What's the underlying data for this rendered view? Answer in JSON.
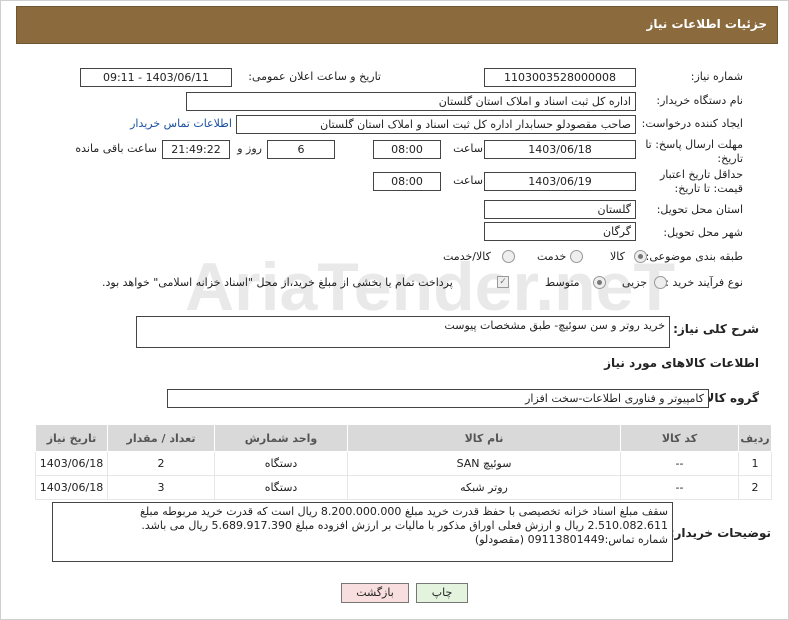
{
  "header": {
    "title": "جزئیات اطلاعات نیاز"
  },
  "watermark": {
    "text": "AriaTender.neT"
  },
  "form": {
    "need_number_label": "شماره نیاز:",
    "need_number": "1103003528000008",
    "announce_label": "تاریخ و ساعت اعلان عمومی:",
    "announce_value": "1403/06/11 - 09:11",
    "buyer_org_label": "نام دستگاه خریدار:",
    "buyer_org": "اداره کل ثبت اسناد و املاک استان گلستان",
    "creator_label": "ایجاد کننده درخواست:",
    "creator": "صاحب مقصودلو حسابدار اداره کل ثبت اسناد و املاک استان گلستان",
    "contact_link": "اطلاعات تماس خریدار",
    "deadline_label": "مهلت ارسال پاسخ: تا تاریخ:",
    "deadline_date": "1403/06/18",
    "time_label": "ساعت",
    "deadline_time": "08:00",
    "days_value": "6",
    "days_label": "روز و",
    "remaining_time": "21:49:22",
    "remaining_label": "ساعت باقی مانده",
    "validity_label": "حداقل تاریخ اعتبار قیمت: تا تاریخ:",
    "validity_date": "1403/06/19",
    "validity_time": "08:00",
    "province_label": "استان محل تحویل:",
    "province": "گلستان",
    "city_label": "شهر محل تحویل:",
    "city": "گرگان",
    "category_label": "طبقه بندی موضوعی:",
    "category_options": [
      "کالا",
      "خدمت",
      "کالا/خدمت"
    ],
    "process_label": "نوع فرآیند خرید :",
    "process_options": [
      "جزیی",
      "متوسط"
    ],
    "payment_note": "پرداخت تمام یا بخشی از مبلغ خرید،از محل \"اسناد خزانه اسلامی\" خواهد بود.",
    "summary_label": "شرح کلی نیاز:",
    "summary": "خرید روتر و سن سوئیچ- طبق مشخصات پیوست",
    "goods_info_title": "اطلاعات کالاهای مورد نیاز",
    "goods_group_label": "گروه کالا:",
    "goods_group": "کامپیوتر و فناوری اطلاعات-سخت افزار"
  },
  "table": {
    "headers": [
      "ردیف",
      "کد کالا",
      "نام کالا",
      "واحد شمارش",
      "تعداد / مقدار",
      "تاریخ نیاز"
    ],
    "rows": [
      [
        "1",
        "--",
        "سوئیچ SAN",
        "دستگاه",
        "2",
        "1403/06/18"
      ],
      [
        "2",
        "--",
        "روتر شبکه",
        "دستگاه",
        "3",
        "1403/06/18"
      ]
    ]
  },
  "notes": {
    "label": "توضیحات خریدار:",
    "line1": "سقف مبلغ اسناد خزانه تخصیصی با حفظ قدرت خرید مبلغ  8.200.000.000 ریال است که قدرت خرید مربوطه مبلغ",
    "line2": "2.510.082.611 ریال و ارزش فعلی اوراق مذکور با مالیات بر ارزش افزوده مبلغ 5.689.917.390 ریال می باشد.",
    "line3": "شماره تماس:09113801449 (مقصودلو)"
  },
  "buttons": {
    "print": "چاپ",
    "back": "بازگشت"
  }
}
